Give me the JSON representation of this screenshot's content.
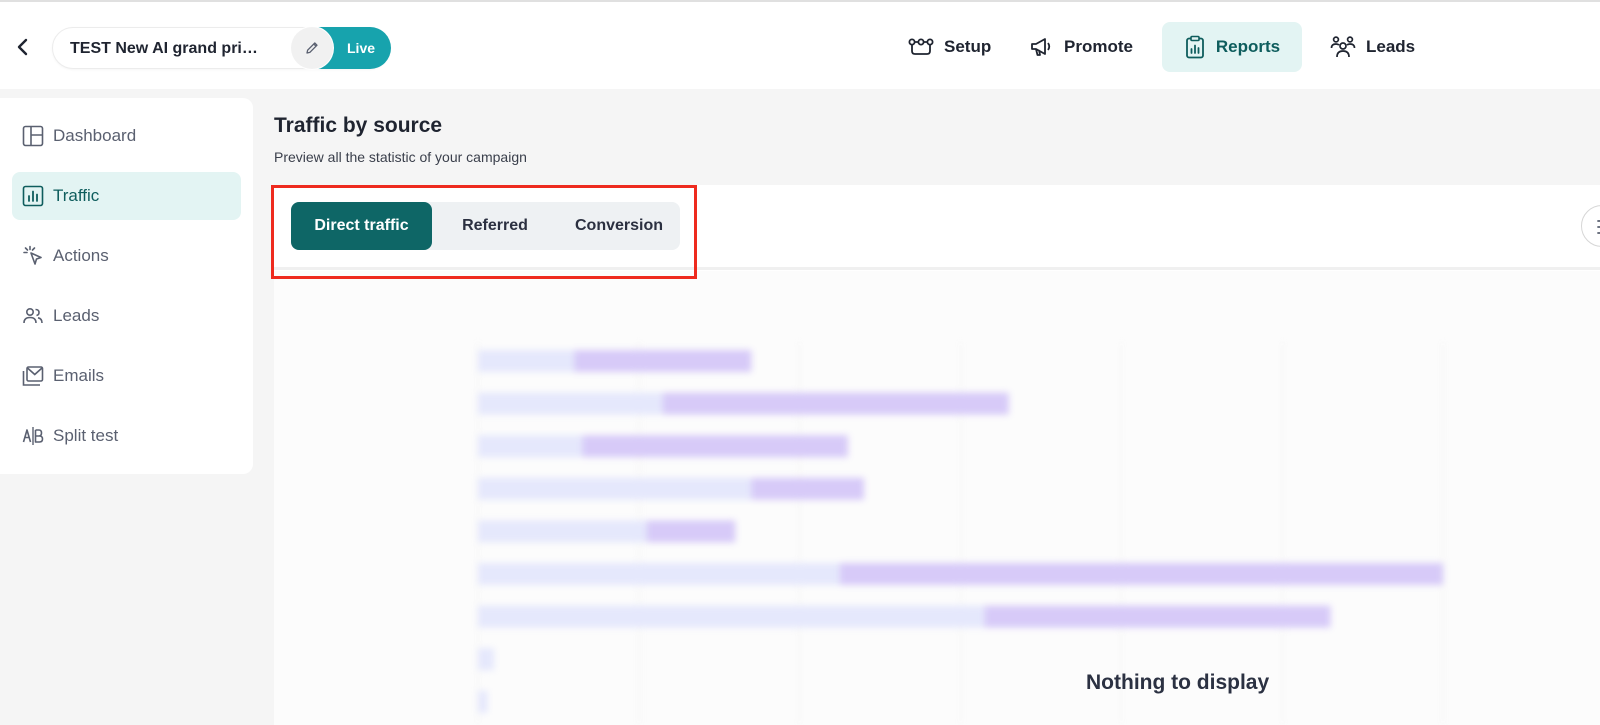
{
  "header": {
    "campaign_name": "TEST New AI grand pri…",
    "status_label": "Live",
    "nav": [
      {
        "label": "Setup",
        "icon": "setup-icon"
      },
      {
        "label": "Promote",
        "icon": "megaphone-icon"
      },
      {
        "label": "Reports",
        "icon": "clipboard-chart-icon",
        "active": true
      },
      {
        "label": "Leads",
        "icon": "people-icon"
      }
    ]
  },
  "sidebar": {
    "items": [
      {
        "label": "Dashboard",
        "icon": "dashboard-icon"
      },
      {
        "label": "Traffic",
        "icon": "bar-chart-icon",
        "active": true
      },
      {
        "label": "Actions",
        "icon": "click-icon"
      },
      {
        "label": "Leads",
        "icon": "people-icon"
      },
      {
        "label": "Emails",
        "icon": "mail-icon"
      },
      {
        "label": "Split test",
        "icon": "ab-icon"
      }
    ]
  },
  "main": {
    "title": "Traffic by source",
    "subtitle": "Preview all the statistic of your campaign",
    "tabs": [
      {
        "label": "Direct traffic",
        "active": true
      },
      {
        "label": "Referred"
      },
      {
        "label": "Conversion"
      }
    ],
    "empty_message": "Nothing to display"
  },
  "colors": {
    "accent": "#0e6666",
    "live": "#17a3ad",
    "bar_light": "#e3e6fc",
    "bar_dark": "#d3c5f8",
    "highlight": "#ee2a1e"
  },
  "chart_data": {
    "type": "bar",
    "orientation": "horizontal",
    "stacked": true,
    "categories": [
      "",
      "",
      "",
      "",
      "",
      "",
      "",
      "",
      ""
    ],
    "series": [
      {
        "values": [
          0.6,
          1.15,
          0.65,
          1.7,
          1.05,
          2.25,
          3.15,
          0.1,
          0.06
        ]
      },
      {
        "values": [
          1.1,
          2.15,
          1.65,
          0.7,
          0.55,
          3.75,
          2.15,
          0,
          0
        ]
      }
    ],
    "xlim": [
      0,
      7
    ],
    "grid": true
  }
}
